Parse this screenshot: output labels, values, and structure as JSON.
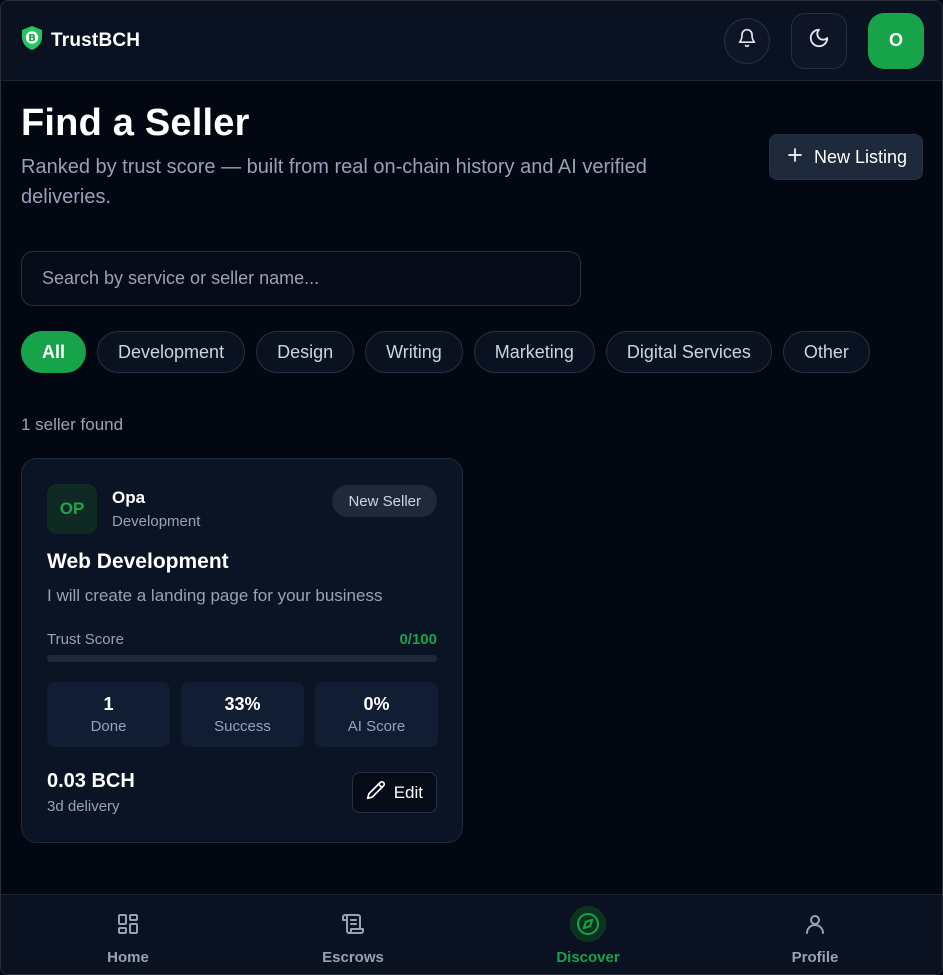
{
  "brand": {
    "name": "TrustBCH"
  },
  "header": {
    "avatar_letter": "O"
  },
  "main": {
    "title": "Find a Seller",
    "subtitle": "Ranked by trust score — built from real on-chain history and AI verified deliveries.",
    "new_listing_label": "New Listing",
    "search": {
      "placeholder": "Search by service or seller name...",
      "value": ""
    },
    "categories": [
      "All",
      "Development",
      "Design",
      "Writing",
      "Marketing",
      "Digital Services",
      "Other"
    ],
    "active_category": "All",
    "results_count": "1 seller found"
  },
  "listings": [
    {
      "initials": "OP",
      "seller_name": "Opa",
      "seller_category": "Development",
      "badge": "New Seller",
      "service_title": "Web Development",
      "description": "I will create a landing page for your business",
      "trust_label": "Trust Score",
      "trust_value": "0/100",
      "trust_fraction": 0,
      "stats": [
        {
          "value": "1",
          "label": "Done"
        },
        {
          "value": "33%",
          "label": "Success"
        },
        {
          "value": "0%",
          "label": "AI Score"
        }
      ],
      "price": "0.03 BCH",
      "delivery": "3d delivery",
      "edit_label": "Edit"
    }
  ],
  "bottom_nav": [
    {
      "label": "Home",
      "icon": "grid-icon",
      "active": false
    },
    {
      "label": "Escrows",
      "icon": "scroll-icon",
      "active": false
    },
    {
      "label": "Discover",
      "icon": "compass-icon",
      "active": true
    },
    {
      "label": "Profile",
      "icon": "user-icon",
      "active": false
    }
  ],
  "colors": {
    "accent": "#16a34a",
    "background": "#030712",
    "surface": "#0b1424"
  }
}
